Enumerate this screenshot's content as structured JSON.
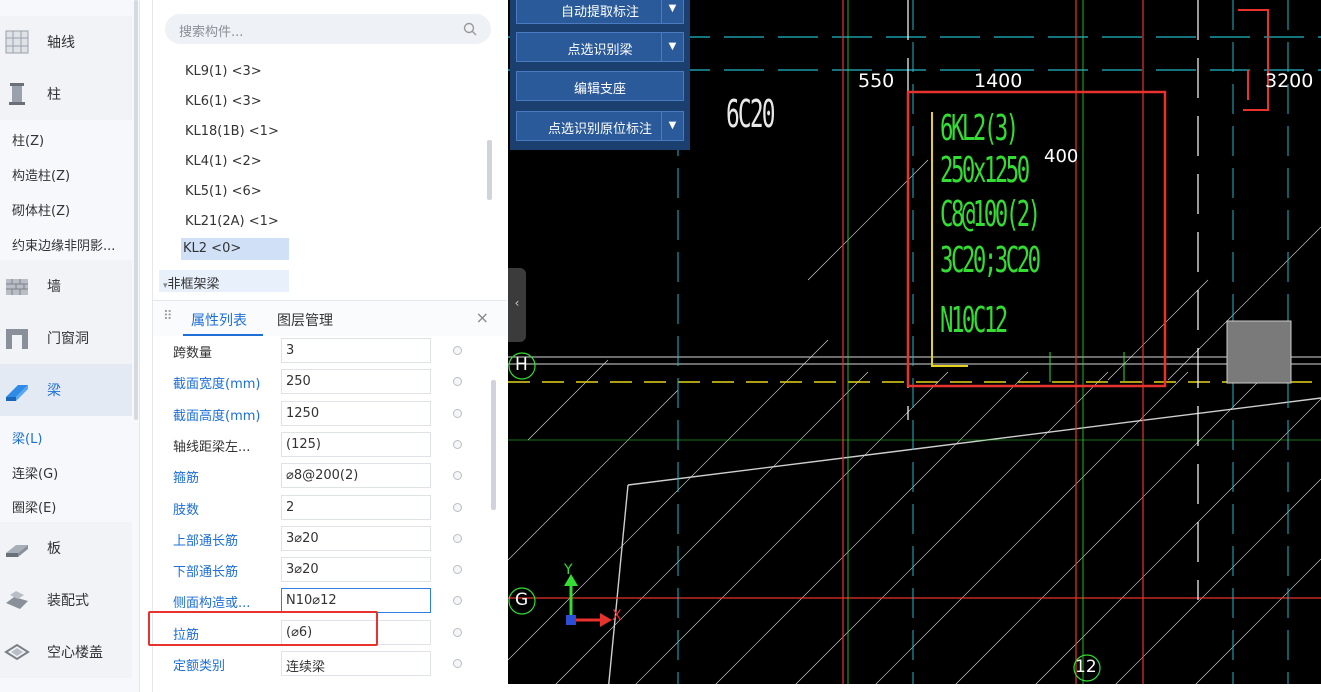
{
  "nav": {
    "categories": [
      {
        "label": "轴线",
        "icon": "grid-icon"
      },
      {
        "label": "柱",
        "icon": "column-icon"
      },
      {
        "label": "墙",
        "icon": "wall-icon"
      },
      {
        "label": "门窗洞",
        "icon": "door-window-icon"
      },
      {
        "label": "梁",
        "icon": "beam-icon"
      },
      {
        "label": "板",
        "icon": "slab-icon"
      },
      {
        "label": "装配式",
        "icon": "prefab-icon"
      },
      {
        "label": "空心楼盖",
        "icon": "hollow-floor-icon"
      }
    ],
    "column_subs": [
      "柱(Z)",
      "构造柱(Z)",
      "砌体柱(Z)",
      "约束边缘非阴影..."
    ],
    "beam_subs": [
      "梁(L)",
      "连梁(G)",
      "圈梁(E)"
    ]
  },
  "panel": {
    "search_placeholder": "搜索构件...",
    "components": [
      "KL9(1) <3>",
      "KL6(1) <3>",
      "KL18(1B) <1>",
      "KL4(1) <2>",
      "KL5(1) <6>",
      "KL21(2A) <1>",
      "KL2 <0>"
    ],
    "group": "非框架梁",
    "tab_props": "属性列表",
    "tab_layers": "图层管理",
    "close": "×",
    "props": [
      {
        "name": "跨数量",
        "value": "3",
        "blue": false
      },
      {
        "name": "截面宽度(mm)",
        "value": "250",
        "blue": true
      },
      {
        "name": "截面高度(mm)",
        "value": "1250",
        "blue": true
      },
      {
        "name": "轴线距梁左...",
        "value": "(125)",
        "blue": false
      },
      {
        "name": "箍筋",
        "value": "⌀8@200(2)",
        "blue": true
      },
      {
        "name": "肢数",
        "value": "2",
        "blue": true
      },
      {
        "name": "上部通长筋",
        "value": "3⌀20",
        "blue": true
      },
      {
        "name": "下部通长筋",
        "value": "3⌀20",
        "blue": true
      },
      {
        "name": "侧面构造或...",
        "value": "N10⌀12",
        "blue": true
      },
      {
        "name": "拉筋",
        "value": "(⌀6)",
        "blue": true
      },
      {
        "name": "定额类别",
        "value": "连续梁",
        "blue": true
      }
    ]
  },
  "toolbar": {
    "auto_extract": "自动提取标注",
    "pick_beam": "点选识别梁",
    "edit_support": "编辑支座",
    "pick_in_situ": "点选识别原位标注",
    "dropdown": "▼"
  },
  "cad": {
    "dims": [
      "550",
      "1400",
      "3200",
      "400"
    ],
    "label_6c20": "6C20",
    "beam_lines": [
      "6KL2(3)",
      "250x1250",
      "C8@100(2)",
      "3C20;3C20",
      "N10C12"
    ],
    "axis_h": "H",
    "axis_g": "G",
    "axis_12": "12",
    "ucs_x": "X",
    "ucs_y": "Y",
    "colors": {
      "green": "#33dd33",
      "red": "#e8322d",
      "cyan": "#22b8c8",
      "yellow": "#e6d21c"
    }
  }
}
